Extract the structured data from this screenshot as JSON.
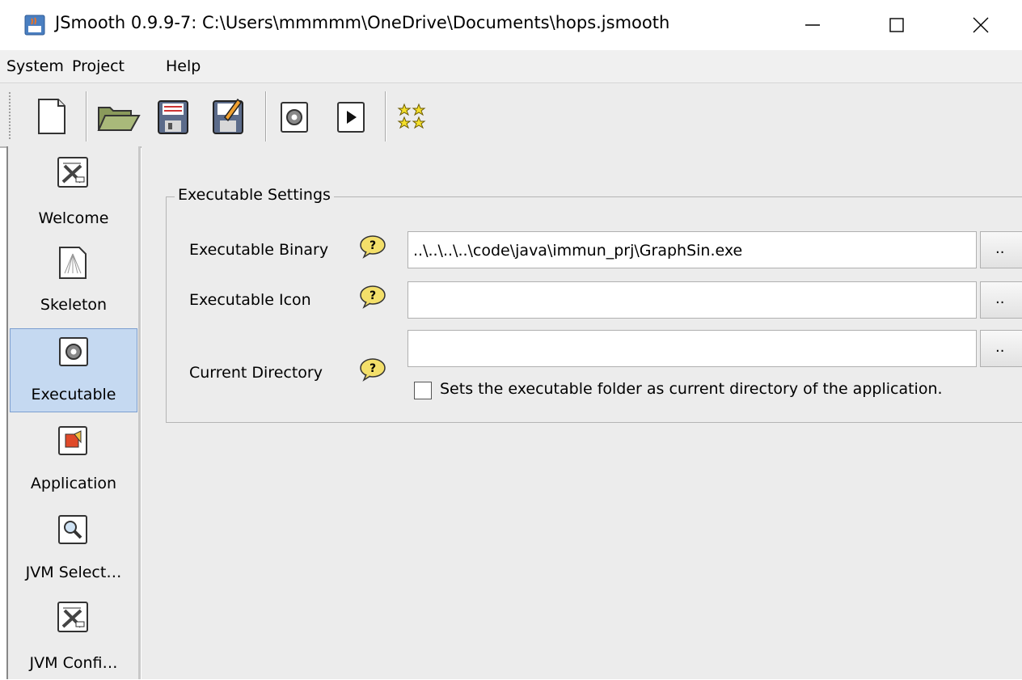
{
  "window": {
    "title": "JSmooth 0.9.9-7: C:\\Users\\mmmmm\\OneDrive\\Documents\\hops.jsmooth"
  },
  "menu": {
    "items": [
      {
        "label": "System"
      },
      {
        "label": "Project"
      },
      {
        "label": "Help"
      }
    ]
  },
  "toolbar": {
    "buttons": [
      "new-file-icon",
      "open-folder-icon",
      "save-icon",
      "save-as-icon",
      "compile-icon",
      "run-icon",
      "wizard-stars-icon"
    ]
  },
  "sidebar": {
    "items": [
      {
        "label": "Welcome",
        "icon": "tools-icon",
        "selected": false
      },
      {
        "label": "Skeleton",
        "icon": "skeleton-icon",
        "selected": false
      },
      {
        "label": "Executable",
        "icon": "gear-icon",
        "selected": true
      },
      {
        "label": "Application",
        "icon": "application-icon",
        "selected": false
      },
      {
        "label": "JVM Select…",
        "icon": "magnifier-icon",
        "selected": false
      },
      {
        "label": "JVM Confi…",
        "icon": "tools-icon",
        "selected": false
      }
    ]
  },
  "executable_settings": {
    "legend": "Executable Settings",
    "binary": {
      "label": "Executable Binary",
      "value": "..\\..\\..\\..\\code\\java\\immun_prj\\GraphSin.exe",
      "browse": ".."
    },
    "icon": {
      "label": "Executable Icon",
      "value": "",
      "browse": ".."
    },
    "directory": {
      "label": "Current Directory",
      "value": "",
      "browse": ".."
    },
    "checkbox_label": "Sets the executable folder as current directory of the application."
  }
}
